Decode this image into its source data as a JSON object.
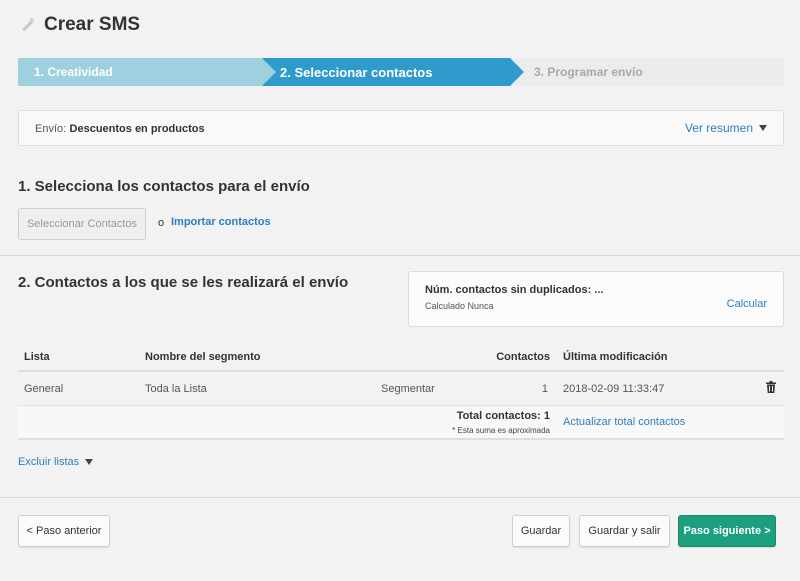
{
  "header": {
    "title": "Crear SMS",
    "icon": "magic-wand-icon"
  },
  "steps": [
    {
      "label": "1. Creatividad",
      "state": "done",
      "color": "#9fd0e0"
    },
    {
      "label": "2. Seleccionar contactos",
      "state": "active",
      "color": "#2f9bcb"
    },
    {
      "label": "3. Programar envío",
      "state": "pending",
      "color": "#ececec"
    }
  ],
  "summary": {
    "label": "Envío:",
    "value": "Descuentos en productos",
    "toggle": "Ver resumen"
  },
  "section1": {
    "title": "1. Selecciona los contactos para el envío",
    "select_button": "Seleccionar Contactos",
    "separator": "o",
    "import_link": "Importar contactos"
  },
  "section2": {
    "title": "2. Contactos a los que se les realizará el envío",
    "count_box": {
      "title": "Núm. contactos sin duplicados: ...",
      "subtitle": "Calculado Nunca",
      "action": "Calcular"
    },
    "table": {
      "headers": [
        "Lista",
        "Nombre del segmento",
        "Contactos",
        "Última modificación"
      ],
      "rows": [
        {
          "lista": "General",
          "segmento": "Toda la Lista",
          "action": "Segmentar",
          "contactos": "1",
          "modificacion": "2018-02-09 11:33:47"
        }
      ],
      "footer": {
        "total": "Total contactos: 1",
        "note": "* Esta suma es aproximada",
        "update_link": "Actualizar total contactos"
      }
    },
    "exclude": "Excluir listas"
  },
  "footer": {
    "prev": "< Paso anterior",
    "save": "Guardar",
    "save_exit": "Guardar y salir",
    "next": "Paso siguiente >"
  },
  "colors": {
    "accent": "#2f9bcb",
    "link": "#2b7fc1",
    "primary_button": "#1b9f7e"
  }
}
